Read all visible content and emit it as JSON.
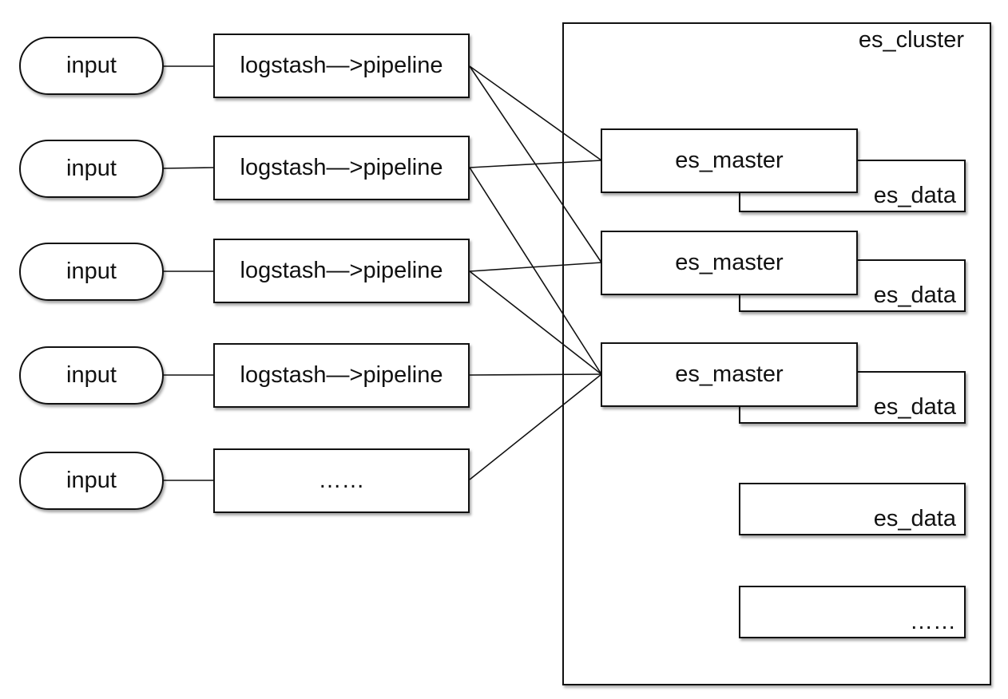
{
  "diagram": {
    "inputs": [
      {
        "label": "input"
      },
      {
        "label": "input"
      },
      {
        "label": "input"
      },
      {
        "label": "input"
      },
      {
        "label": "input"
      }
    ],
    "pipelines": [
      {
        "label": "logstash—>pipeline"
      },
      {
        "label": "logstash—>pipeline"
      },
      {
        "label": "logstash—>pipeline"
      },
      {
        "label": "logstash—>pipeline"
      },
      {
        "label": "……"
      }
    ],
    "cluster": {
      "label": "es_cluster",
      "masters": [
        {
          "label": "es_master"
        },
        {
          "label": "es_master"
        },
        {
          "label": "es_master"
        }
      ],
      "data_nodes": [
        {
          "label": "es_data"
        },
        {
          "label": "es_data"
        },
        {
          "label": "es_data"
        },
        {
          "label": "es_data"
        },
        {
          "label": "……"
        }
      ]
    },
    "edges": [
      {
        "from": "input-1",
        "to": "pipeline-1"
      },
      {
        "from": "input-2",
        "to": "pipeline-2"
      },
      {
        "from": "input-3",
        "to": "pipeline-3"
      },
      {
        "from": "input-4",
        "to": "pipeline-4"
      },
      {
        "from": "input-5",
        "to": "pipeline-5"
      },
      {
        "from": "pipeline-1",
        "to": "master-1"
      },
      {
        "from": "pipeline-1",
        "to": "master-2"
      },
      {
        "from": "pipeline-2",
        "to": "master-1"
      },
      {
        "from": "pipeline-2",
        "to": "master-3"
      },
      {
        "from": "pipeline-3",
        "to": "master-2"
      },
      {
        "from": "pipeline-3",
        "to": "master-3"
      },
      {
        "from": "pipeline-4",
        "to": "master-3"
      },
      {
        "from": "pipeline-5",
        "to": "master-3"
      }
    ]
  }
}
